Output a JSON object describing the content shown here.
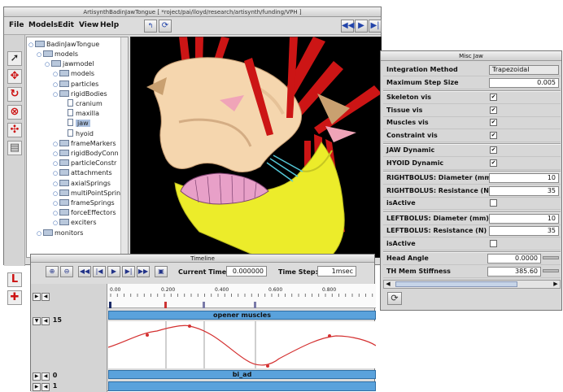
{
  "main_window": {
    "title": "ArtisynthBadinJawTongue [ *roject/pai/lloyd/research/artisynth/funding/VPH ]",
    "menus": [
      "File",
      "Models",
      "Edit",
      "View",
      "Help"
    ]
  },
  "tree": {
    "root": "BadinJawTongue",
    "items": [
      {
        "label": "models",
        "indent": 1,
        "kind": "folder"
      },
      {
        "label": "jawmodel",
        "indent": 2,
        "kind": "folder"
      },
      {
        "label": "models",
        "indent": 3,
        "kind": "folder"
      },
      {
        "label": "particles",
        "indent": 3,
        "kind": "folder"
      },
      {
        "label": "rigidBodies",
        "indent": 3,
        "kind": "folder"
      },
      {
        "label": "cranium",
        "indent": 4,
        "kind": "doc"
      },
      {
        "label": "maxilla",
        "indent": 4,
        "kind": "doc"
      },
      {
        "label": "jaw",
        "indent": 4,
        "kind": "doc",
        "selected": true
      },
      {
        "label": "hyoid",
        "indent": 4,
        "kind": "doc"
      },
      {
        "label": "frameMarkers",
        "indent": 3,
        "kind": "folder"
      },
      {
        "label": "rigidBodyConn",
        "indent": 3,
        "kind": "folder"
      },
      {
        "label": "particleConstr",
        "indent": 3,
        "kind": "folder"
      },
      {
        "label": "attachments",
        "indent": 3,
        "kind": "folder"
      },
      {
        "label": "axialSprings",
        "indent": 3,
        "kind": "folder"
      },
      {
        "label": "multiPointSprin",
        "indent": 3,
        "kind": "folder"
      },
      {
        "label": "frameSprings",
        "indent": 3,
        "kind": "folder"
      },
      {
        "label": "forceEffectors",
        "indent": 3,
        "kind": "folder"
      },
      {
        "label": "exciters",
        "indent": 3,
        "kind": "folder"
      },
      {
        "label": "monitors",
        "indent": 1,
        "kind": "folder"
      }
    ]
  },
  "timeline": {
    "title": "Timeline",
    "current_time_label": "Current Time:",
    "current_time": "0.000000",
    "time_step_label": "Time Step:",
    "time_step": "1msec",
    "ticks": [
      "0.00",
      "0.200",
      "0.400",
      "0.600",
      "0.800"
    ],
    "tracks": [
      {
        "label": "opener muscles",
        "number": "15"
      },
      {
        "label": "bi_ad",
        "number": "0"
      },
      {
        "label": "",
        "number": "1"
      }
    ]
  },
  "panel": {
    "title": "Misc Jaw",
    "rows": [
      {
        "label": "Integration Method",
        "value": "Trapezoidal",
        "type": "text"
      },
      {
        "label": "Maximum Step Size",
        "value": "0.005",
        "type": "text"
      },
      {
        "label": "Skeleton vis",
        "value": "✔",
        "type": "check"
      },
      {
        "label": "Tissue vis",
        "value": "✔",
        "type": "check"
      },
      {
        "label": "Muscles vis",
        "value": "✔",
        "type": "check"
      },
      {
        "label": "Constraint vis",
        "value": "✔",
        "type": "check"
      },
      {
        "label": "JAW Dynamic",
        "value": "✔",
        "type": "check"
      },
      {
        "label": "HYOID Dynamic",
        "value": "✔",
        "type": "check"
      },
      {
        "label": "RIGHTBOLUS: Diameter (mm)",
        "value": "10",
        "type": "text"
      },
      {
        "label": "RIGHTBOLUS: Resistance (N)",
        "value": "35",
        "type": "text"
      },
      {
        "label": "isActive",
        "value": "",
        "type": "check"
      },
      {
        "label": "LEFTBOLUS: Diameter (mm)",
        "value": "10",
        "type": "text"
      },
      {
        "label": "LEFTBOLUS: Resistance (N)",
        "value": "35",
        "type": "text"
      },
      {
        "label": "isActive",
        "value": "",
        "type": "check"
      },
      {
        "label": "Head Angle",
        "value": "0.0000",
        "type": "text"
      },
      {
        "label": "TH Mem Stiffness",
        "value": "385.60",
        "type": "text"
      }
    ]
  },
  "colors": {
    "accent": "#cc1111",
    "track": "#5aa2dc",
    "curve": "#d43030"
  }
}
